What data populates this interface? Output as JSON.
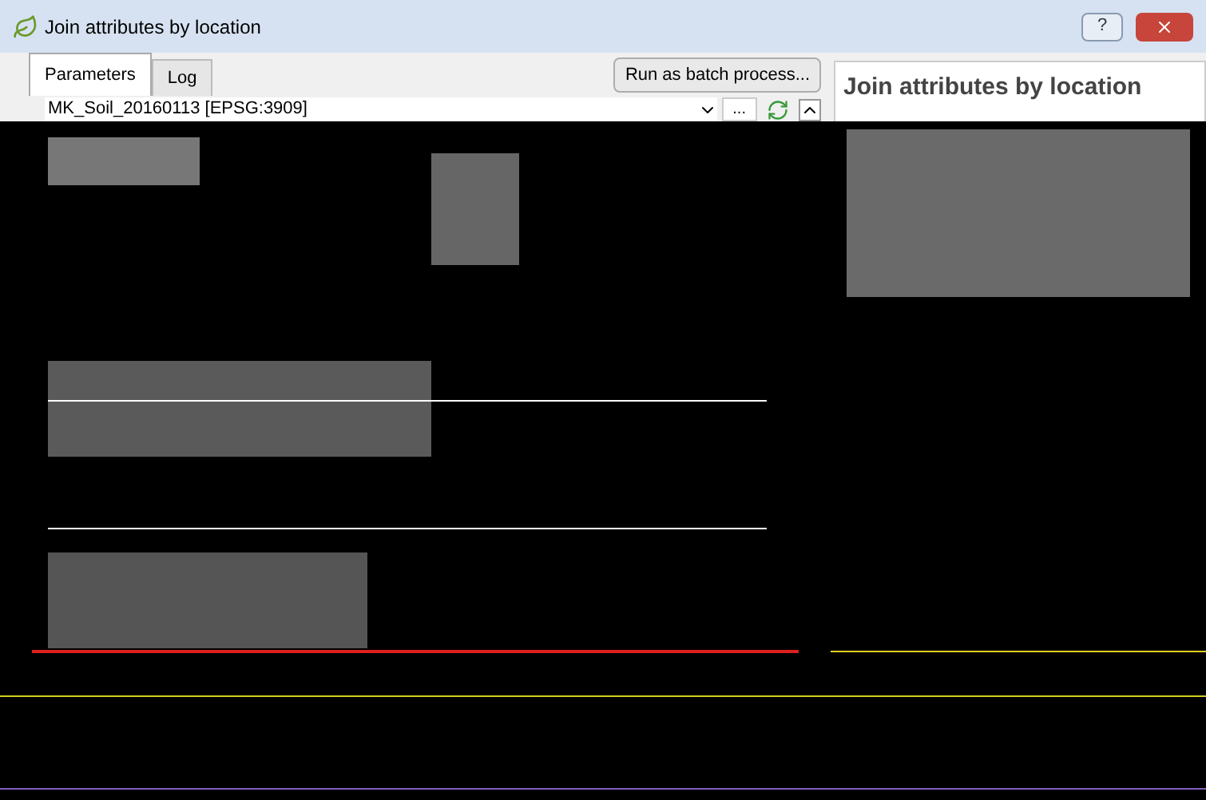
{
  "window": {
    "title": "Join attributes by location",
    "help_label": "?"
  },
  "tabs": [
    {
      "label": "Parameters",
      "selected": true
    },
    {
      "label": "Log",
      "selected": false
    }
  ],
  "batch_button": "Run as batch process...",
  "layer_combo": {
    "value": "MK_Soil_20160113 [EPSG:3909]",
    "browse_label": "..."
  },
  "help_panel": {
    "title": "Join attributes by location"
  }
}
